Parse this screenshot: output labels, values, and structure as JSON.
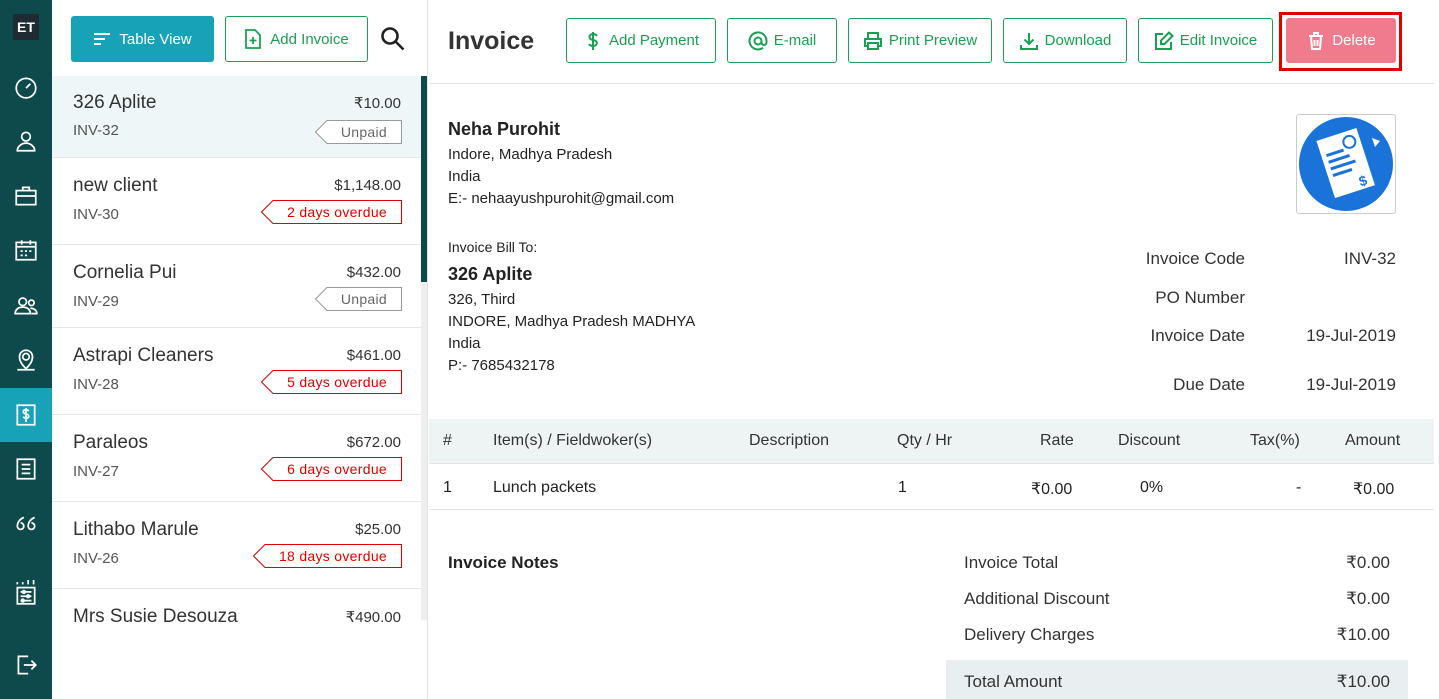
{
  "app": {
    "logo": "ET"
  },
  "rail": {
    "items": [
      "dashboard-icon",
      "user-icon",
      "briefcase-icon",
      "calendar-icon",
      "users-icon",
      "map-pin-icon",
      "dollar-icon",
      "list-icon",
      "quote-icon",
      "sliders-icon",
      "logout-icon"
    ],
    "active": 6
  },
  "toolbar": {
    "table_view": "Table View",
    "add_invoice": "Add Invoice"
  },
  "invoices": [
    {
      "name": "326 Aplite",
      "amount": "₹10.00",
      "code": "INV-32",
      "status": "Unpaid",
      "overdue": false
    },
    {
      "name": "new client",
      "amount": "$1,148.00",
      "code": "INV-30",
      "status": "2 days overdue",
      "overdue": true
    },
    {
      "name": "Cornelia Pui",
      "amount": "$432.00",
      "code": "INV-29",
      "status": "Unpaid",
      "overdue": false
    },
    {
      "name": "Astrapi Cleaners",
      "amount": "$461.00",
      "code": "INV-28",
      "status": "5 days overdue",
      "overdue": true
    },
    {
      "name": "Paraleos",
      "amount": "$672.00",
      "code": "INV-27",
      "status": "6 days overdue",
      "overdue": true
    },
    {
      "name": "Lithabo Marule",
      "amount": "$25.00",
      "code": "INV-26",
      "status": "18 days overdue",
      "overdue": true
    },
    {
      "name": "Mrs Susie Desouza",
      "amount": "₹490.00",
      "code": "",
      "status": "",
      "overdue": false
    }
  ],
  "header": {
    "title": "Invoice",
    "actions": {
      "add_payment": "Add Payment",
      "email": "E-mail",
      "print": "Print Preview",
      "download": "Download",
      "edit": "Edit Invoice",
      "delete": "Delete"
    }
  },
  "from": {
    "name": "Neha Purohit",
    "line1": "Indore, Madhya Pradesh",
    "line2": "India",
    "email": "E:- nehaayushpurohit@gmail.com"
  },
  "bill_to": {
    "label": "Invoice Bill To:",
    "name": "326 Aplite",
    "line1": "326, Third",
    "line2": "INDORE, Madhya Pradesh MADHYA",
    "line3": "India",
    "phone": "P:- 7685432178"
  },
  "meta": {
    "code_label": "Invoice Code",
    "code": "INV-32",
    "po_label": "PO Number",
    "po": "",
    "date_label": "Invoice Date",
    "date": "19-Jul-2019",
    "due_label": "Due Date",
    "due": "19-Jul-2019"
  },
  "table": {
    "headers": {
      "num": "#",
      "item": "Item(s) / Fieldwoker(s)",
      "desc": "Description",
      "qty": "Qty / Hr",
      "rate": "Rate",
      "discount": "Discount",
      "tax": "Tax(%)",
      "amount": "Amount"
    },
    "row": {
      "num": "1",
      "item": "Lunch packets",
      "desc": "",
      "qty": "1",
      "rate": "₹0.00",
      "discount": "0%",
      "tax": "-",
      "amount": "₹0.00"
    }
  },
  "notes": {
    "label": "Invoice Notes"
  },
  "summary": {
    "total_label": "Invoice Total",
    "total": "₹0.00",
    "add_disc_label": "Additional Discount",
    "add_disc": "₹0.00",
    "delivery_label": "Delivery Charges",
    "delivery": "₹10.00",
    "grand_label": "Total Amount",
    "grand": "₹10.00"
  }
}
